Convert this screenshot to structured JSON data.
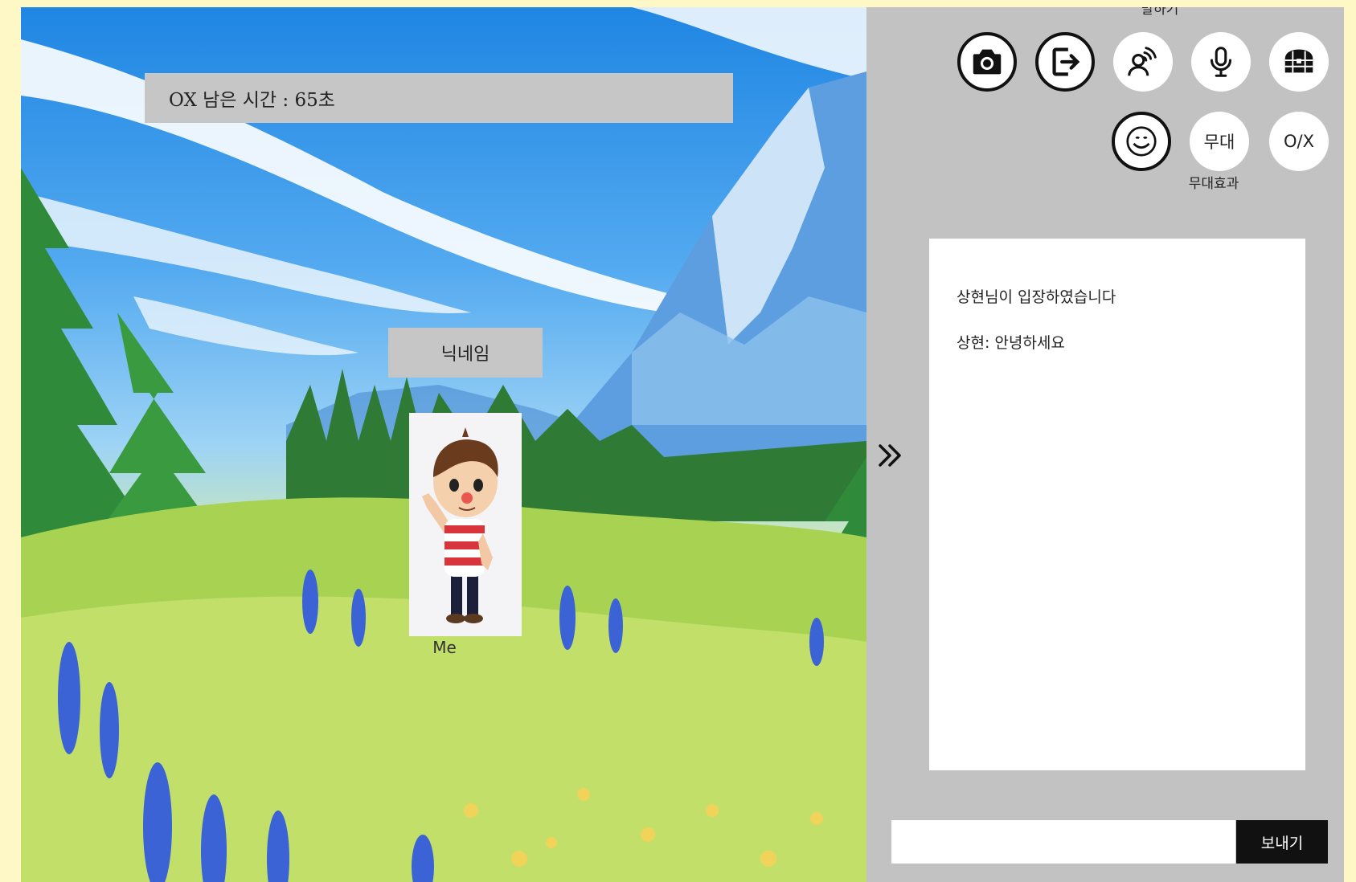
{
  "game": {
    "timer_text": "OX 남은 시간 : 65초",
    "nickname": "닉네임",
    "avatar_label": "Me"
  },
  "panel": {
    "top_label": "말하기",
    "toolbar": [
      {
        "name": "camera",
        "icon": "camera-icon"
      },
      {
        "name": "exit",
        "icon": "exit-icon"
      },
      {
        "name": "voice",
        "icon": "speaking-person-icon"
      },
      {
        "name": "mic",
        "icon": "microphone-icon"
      },
      {
        "name": "storage",
        "icon": "treasure-chest-icon"
      }
    ],
    "emoji_icon": "smiley-icon",
    "stage_button_label": "무대",
    "stage_caption": "무대효과",
    "ox_button_label": "O/X",
    "collapse_icon": "double-chevron-right-icon"
  },
  "chat": {
    "messages": [
      {
        "text": "상현님이 입장하였습니다"
      },
      {
        "text": "상현: 안녕하세요"
      }
    ],
    "input_value": "",
    "send_label": "보내기"
  },
  "colors": {
    "page_background": "#fdf8c6",
    "panel_background": "#c2c2c2",
    "banner_background": "#c6c6c6",
    "send_button": "#111111"
  }
}
